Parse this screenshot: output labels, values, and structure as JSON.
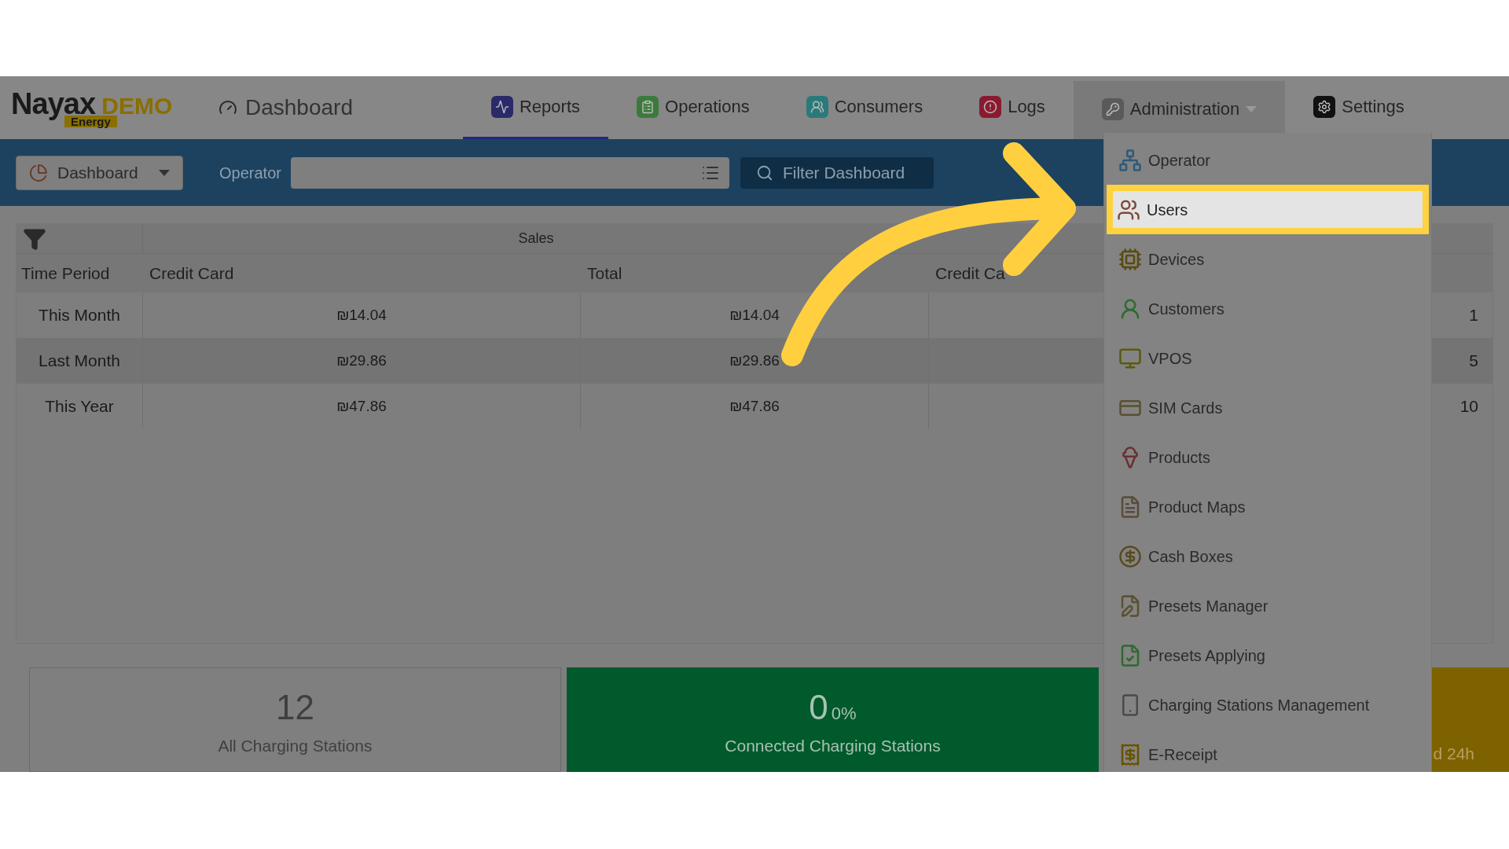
{
  "header": {
    "logo": {
      "brand": "Nayax",
      "tag": "DEMO",
      "sub": "Energy"
    },
    "page_title": "Dashboard",
    "tabs": [
      {
        "label": "Reports",
        "selected": true,
        "expanded": false
      },
      {
        "label": "Operations",
        "selected": false,
        "expanded": false
      },
      {
        "label": "Consumers",
        "selected": false,
        "expanded": false
      },
      {
        "label": "Logs",
        "selected": false,
        "expanded": false
      },
      {
        "label": "Administration",
        "selected": false,
        "expanded": true
      },
      {
        "label": "Settings",
        "selected": false,
        "expanded": false
      }
    ]
  },
  "toolbar": {
    "view_select": {
      "value": "Dashboard"
    },
    "operator_field": {
      "label": "Operator"
    },
    "filter_button": "Filter Dashboard"
  },
  "table": {
    "group_header": "Sales",
    "columns": [
      "Time Period",
      "Credit Card",
      "Total",
      "Credit Ca"
    ],
    "rows": [
      {
        "period": "This Month",
        "credit_card": "₪14.04",
        "total": "₪14.04",
        "column_5": "1"
      },
      {
        "period": "Last Month",
        "credit_card": "₪29.86",
        "total": "₪29.86",
        "column_5": "5"
      },
      {
        "period": "This Year",
        "credit_card": "₪47.86",
        "total": "₪47.86",
        "column_5": "10"
      }
    ]
  },
  "cards": [
    {
      "kind": "plain",
      "value": "12",
      "label": "All Charging Stations"
    },
    {
      "kind": "green",
      "value": "0",
      "percent": "0%",
      "label": "Connected Charging Stations"
    },
    {
      "kind": "amber",
      "label": "d 24h"
    }
  ],
  "admin_menu": {
    "items": [
      {
        "label": "Operator",
        "selected": false
      },
      {
        "label": "Users",
        "selected": true
      },
      {
        "label": "Devices",
        "selected": false
      },
      {
        "label": "Customers",
        "selected": false
      },
      {
        "label": "VPOS",
        "selected": false
      },
      {
        "label": "SIM Cards",
        "selected": false
      },
      {
        "label": "Products",
        "selected": false
      },
      {
        "label": "Product Maps",
        "selected": false
      },
      {
        "label": "Cash Boxes",
        "selected": false
      },
      {
        "label": "Presets Manager",
        "selected": false
      },
      {
        "label": "Presets Applying",
        "selected": false
      },
      {
        "label": "Charging Stations Management",
        "selected": false
      },
      {
        "label": "E-Receipt",
        "selected": false
      }
    ]
  }
}
